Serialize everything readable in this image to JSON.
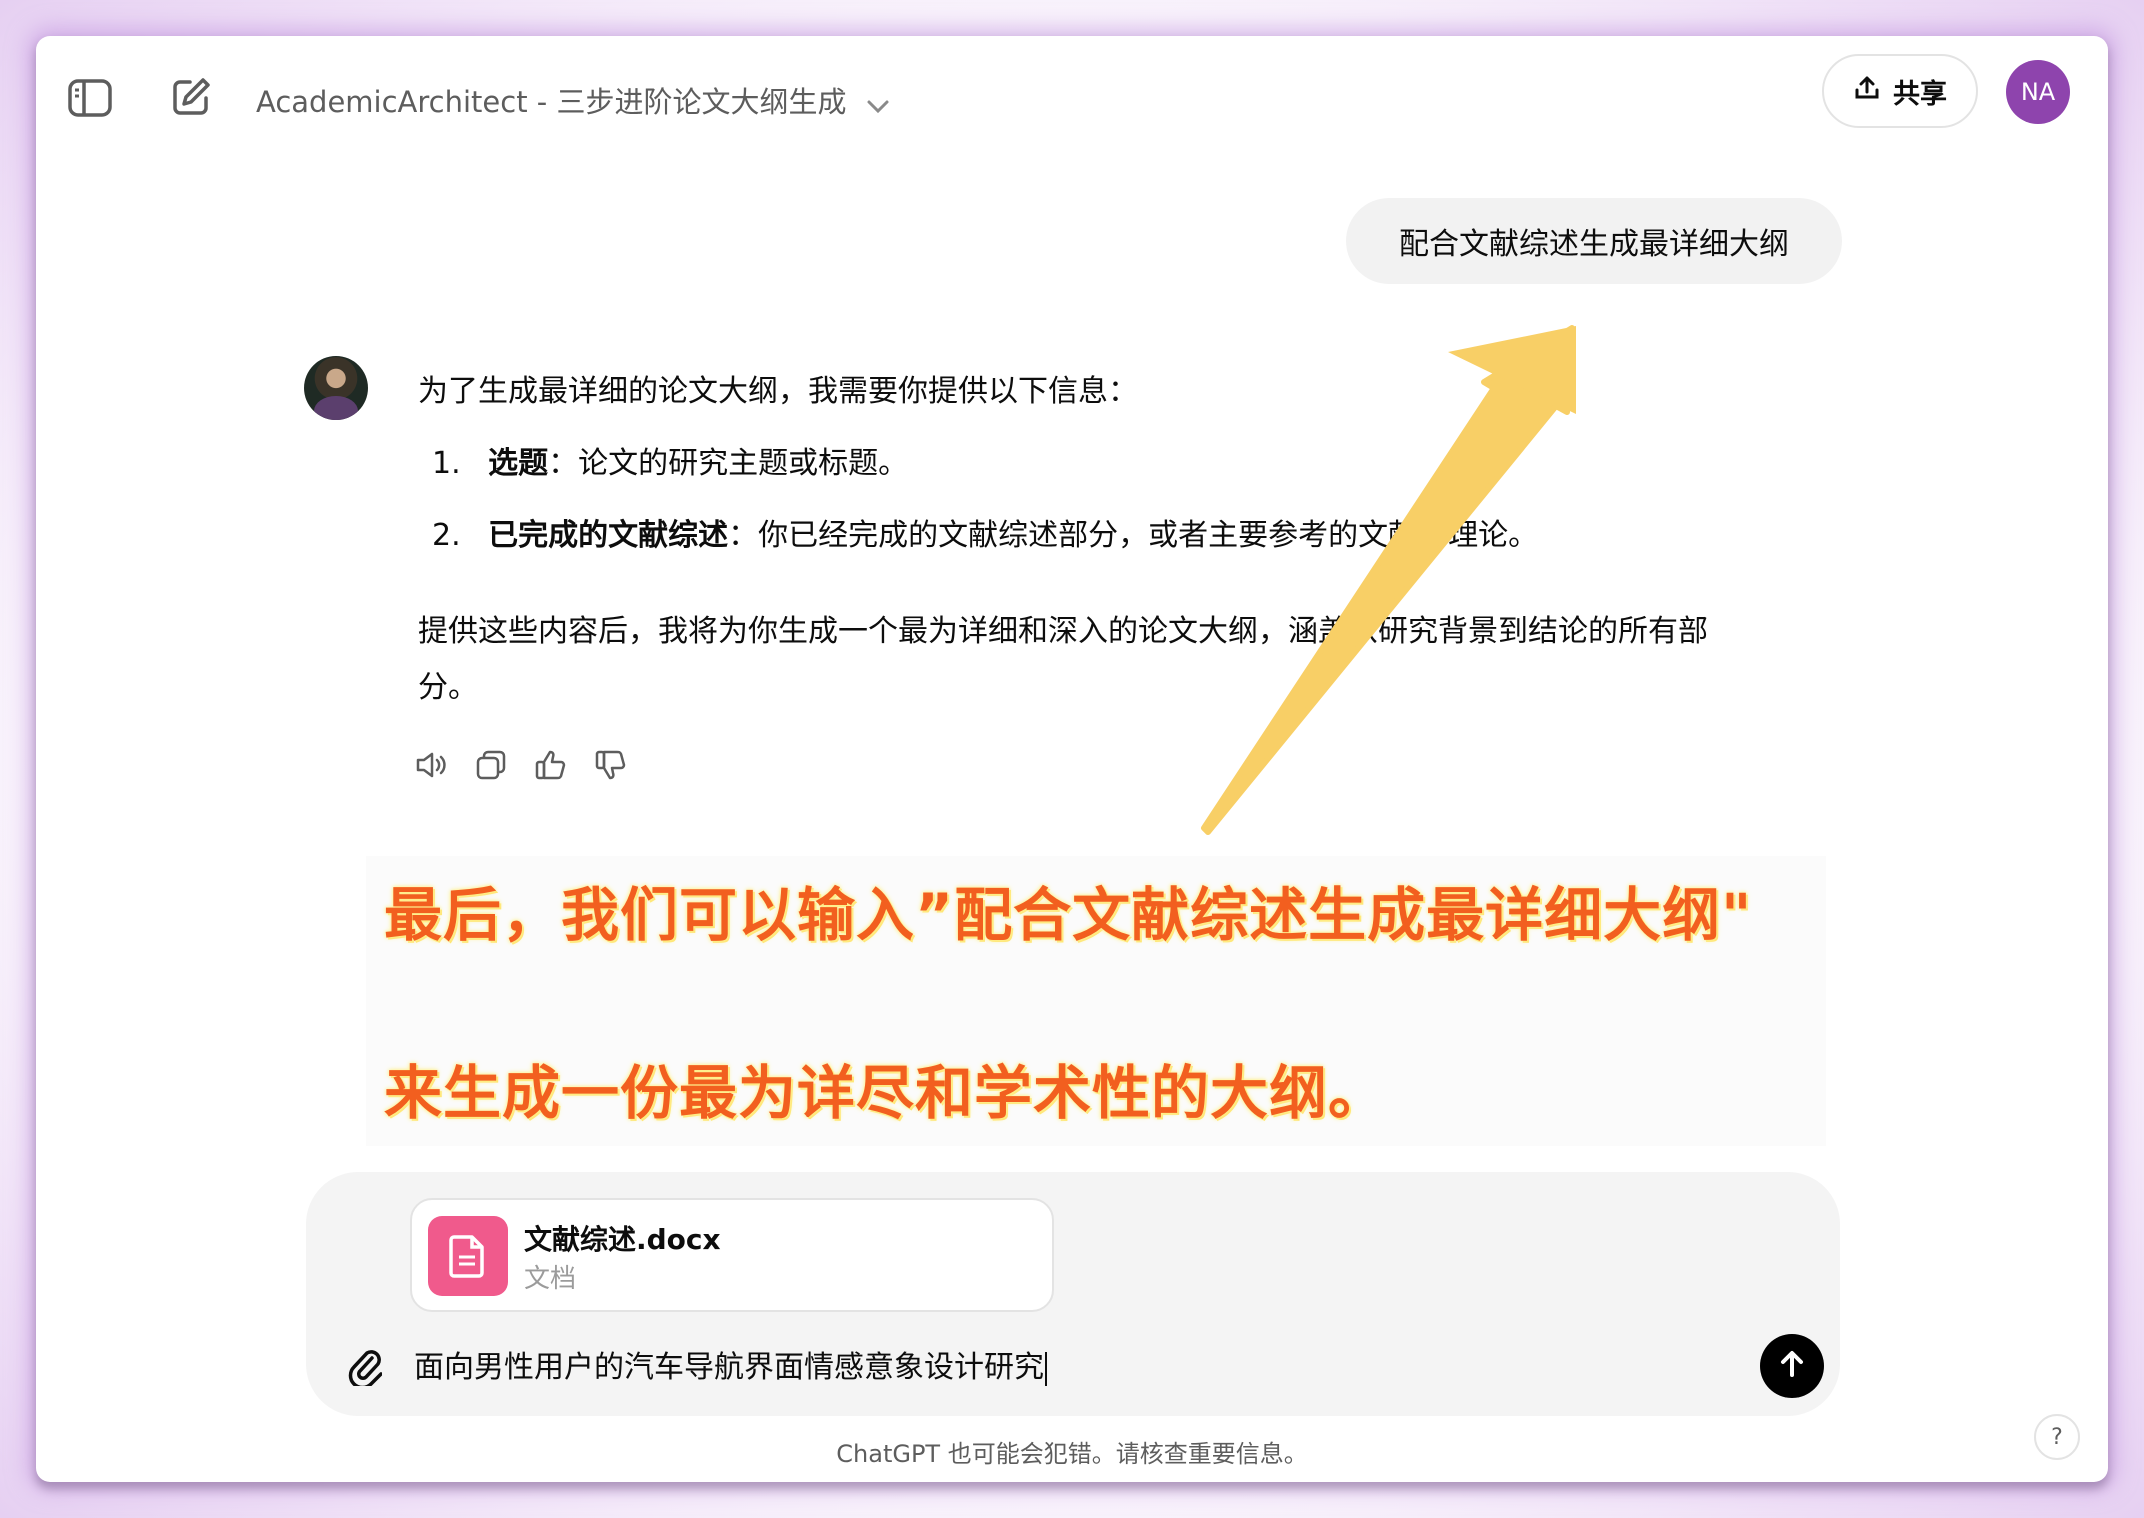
{
  "header": {
    "title": "AcademicArchitect - 三步进阶论文大纲生成",
    "share_label": "共享",
    "user_initials": "NA"
  },
  "conversation": {
    "user_message": "配合文献综述生成最详细大纲",
    "assistant": {
      "intro": "为了生成最详细的论文大纲，我需要你提供以下信息：",
      "items": [
        {
          "num": "1.",
          "title": "选题",
          "sep": "：",
          "text": "论文的研究主题或标题。"
        },
        {
          "num": "2.",
          "title": "已完成的文献综述",
          "sep": "：",
          "text": "你已经完成的文献综述部分，或者主要参考的文献和理论。"
        }
      ],
      "para_line1": "提供这些内容后，我将为你生成一个最为详细和深入的论文大纲，涵盖从研究背景到结论的所有部",
      "para_line2": "分。"
    }
  },
  "annotation": {
    "line1": "最后，我们可以输入”配合文献综述生成最详细大纲\"",
    "line2": "来生成一份最为详尽和学术性的大纲。",
    "arrow_color": "#f8cf66"
  },
  "composer": {
    "file_name": "文献综述.docx",
    "file_type": "文档",
    "input_value": "面向男性用户的汽车导航界面情感意象设计研究"
  },
  "footer": {
    "disclaimer": "ChatGPT 也可能会犯错。请核查重要信息。",
    "help": "?"
  },
  "icons": [
    "sidebar-toggle-icon",
    "new-chat-icon",
    "chevron-down-icon",
    "upload-icon",
    "speaker-icon",
    "copy-icon",
    "thumbs-up-icon",
    "thumbs-down-icon",
    "document-icon",
    "paperclip-icon",
    "arrow-up-icon"
  ],
  "colors": {
    "accent_avatar": "#8e44ad",
    "file_icon_bg": "#f05a8c",
    "annotation_text": "#f25f1f"
  }
}
